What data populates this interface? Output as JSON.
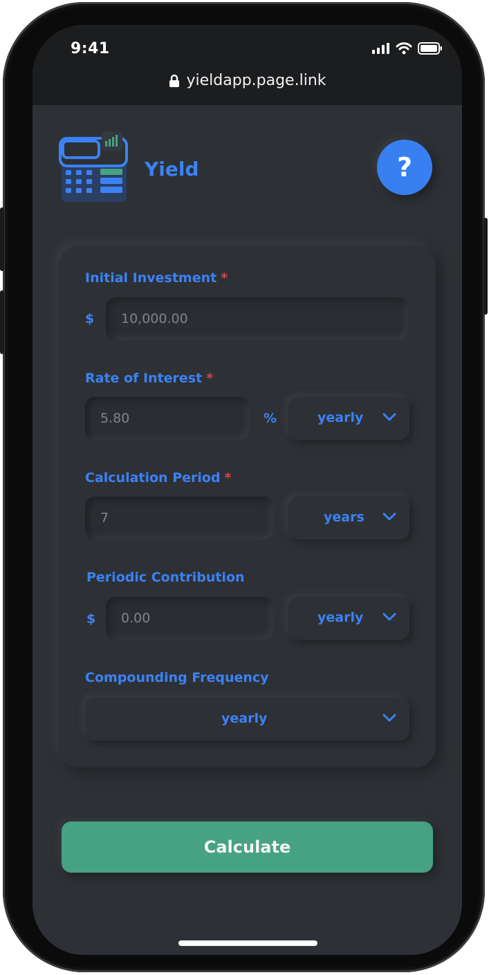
{
  "status_bar": {
    "time": "9:41"
  },
  "browser": {
    "url": "yieldapp.page.link"
  },
  "header": {
    "title": "Yield",
    "help_label": "?"
  },
  "form": {
    "initial_investment": {
      "label": "Initial Investment",
      "required_mark": "*",
      "currency": "$",
      "value": "10,000.00"
    },
    "rate_of_interest": {
      "label": "Rate of Interest",
      "required_mark": "*",
      "value": "5.80",
      "unit": "%",
      "period": "yearly"
    },
    "calculation_period": {
      "label": "Calculation Period",
      "required_mark": "*",
      "value": "7",
      "unit": "years"
    },
    "periodic_contribution": {
      "label": "Periodic Contribution",
      "currency": "$",
      "value": "0.00",
      "period": "yearly"
    },
    "compounding_frequency": {
      "label": "Compounding Frequency",
      "value": "yearly"
    }
  },
  "actions": {
    "calculate_label": "Calculate"
  },
  "colors": {
    "accent": "#3b82f6",
    "required": "#e04545",
    "calculate": "#46a283",
    "background": "#2d3135"
  },
  "icons": [
    "lock-icon",
    "signal-icon",
    "wifi-icon",
    "battery-icon",
    "calculator-logo-icon",
    "chevron-down-icon"
  ]
}
